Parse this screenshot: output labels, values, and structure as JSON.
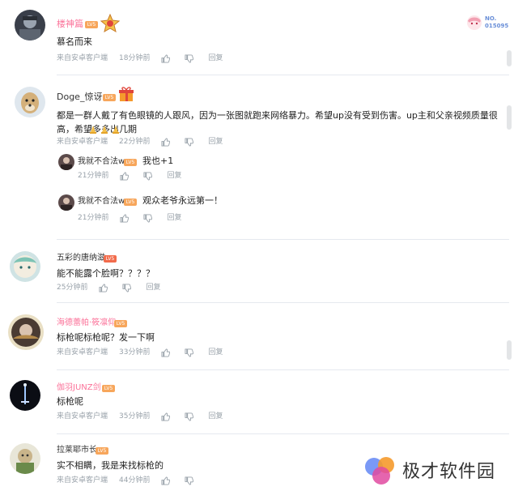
{
  "comments": [
    {
      "user": "楼神篇",
      "level": "LV5",
      "text": "慕名而来",
      "meta": {
        "source": "来自安卓客户端",
        "time": "18分钟前",
        "reply": "回复"
      },
      "badge": {
        "label": "NO.",
        "number": "015095"
      }
    },
    {
      "user": "Doge_惊讶",
      "level": "LV5",
      "text": "都是一群人戴了有色眼镜的人跟风，因为一张图就跑来网络暴力。希望up没有受到伤害。up主和父亲视频质量很高，希望多多出几期",
      "meta": {
        "source": "来自安卓客户端",
        "time": "22分钟前",
        "reply": "回复"
      },
      "replies": [
        {
          "user": "我就不合法w",
          "level": "LV5",
          "text": "我也+1",
          "meta": {
            "time": "21分钟前",
            "reply": "回复"
          }
        },
        {
          "user": "我就不合法w",
          "level": "LV5",
          "text": "观众老爷永远第一！",
          "meta": {
            "time": "21分钟前",
            "reply": "回复"
          }
        }
      ]
    },
    {
      "user": "五彩的唐纳滋",
      "level": "LV5",
      "text": "能不能露个脸啊？？？？",
      "meta": {
        "time": "25分钟前",
        "reply": "回复"
      }
    },
    {
      "user": "海德蕾帕·筱凛仰",
      "level": "LV5",
      "text": "标枪呢标枪呢？发一下啊",
      "meta": {
        "source": "来自安卓客户端",
        "time": "33分钟前",
        "reply": "回复"
      }
    },
    {
      "user": "伽羽JUNZ剑",
      "level": "LV5",
      "text": "标枪呢",
      "meta": {
        "source": "来自安卓客户端",
        "time": "35分钟前",
        "reply": "回复"
      }
    },
    {
      "user": "拉莱耶市长",
      "level": "LV5",
      "text": "实不相瞒，我是来找标枪的",
      "meta": {
        "source": "来自安卓客户端",
        "time": "44分钟前",
        "reply": "回复"
      }
    }
  ],
  "watermark": {
    "text": "极才软件园"
  },
  "colors": {
    "username_pink": "#fb7299",
    "meta_gray": "#99a2aa",
    "divider": "#e5e9ef",
    "level_orange": "#f7a65b"
  },
  "icons": {
    "like": "thumbs-up-icon",
    "dislike": "thumbs-down-icon"
  }
}
